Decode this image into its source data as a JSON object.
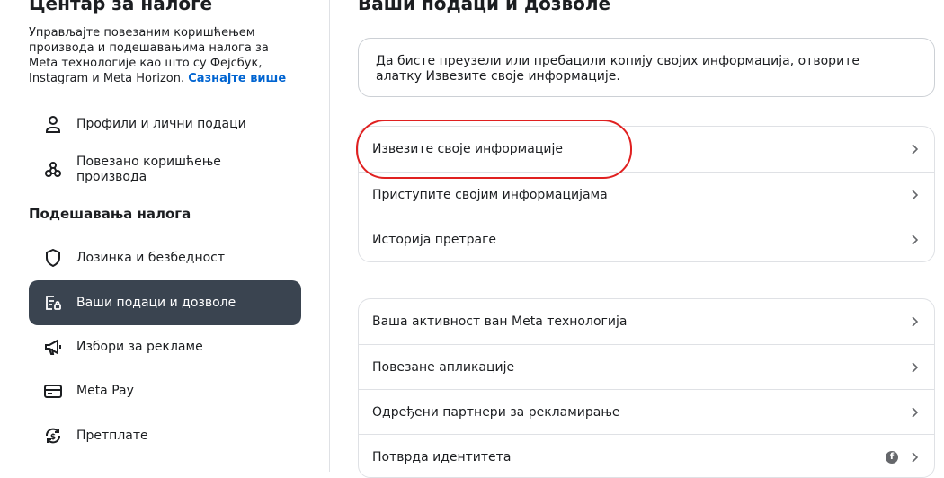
{
  "sidebar": {
    "title": "Центар за налоге",
    "description": "Управљајте повезаним коришћењем производа и подешавањима налога за Meta технологије као што су Фејсбук, Instagram и Meta Horizon.",
    "learn_more": "Сазнајте више",
    "top_items": [
      {
        "label": "Профили и лични подаци",
        "icon": "person-icon"
      },
      {
        "label": "Повезано коришћење производа",
        "icon": "connected-nodes-icon"
      }
    ],
    "section_heading": "Подешавања налога",
    "settings_items": [
      {
        "label": "Лозинка и безбедност",
        "icon": "shield-icon"
      },
      {
        "label": "Ваши подаци и дозволе",
        "icon": "data-permissions-icon",
        "active": true
      },
      {
        "label": "Избори за рекламе",
        "icon": "megaphone-icon"
      },
      {
        "label": "Meta Pay",
        "icon": "card-icon"
      },
      {
        "label": "Претплате",
        "icon": "subscription-icon"
      }
    ]
  },
  "main": {
    "title": "Ваши подаци и дозволе",
    "info_text": "Да бисте преузели или пребацили копију својих информација, отворите алатку Извезите своје информације.",
    "group1": [
      {
        "label": "Извезите своје информације"
      },
      {
        "label": "Приступите својим информацијама"
      },
      {
        "label": "Историја претраге"
      }
    ],
    "group2": [
      {
        "label": "Ваша активност ван Meta технологија"
      },
      {
        "label": "Повезане апликације"
      },
      {
        "label": "Одређени партнери за рекламирање"
      },
      {
        "label": "Потврда идентитета",
        "badge_icon": "facebook-icon"
      }
    ]
  },
  "colors": {
    "active_bg": "#3a4450",
    "link": "#0064d1",
    "highlight": "#e02020"
  }
}
